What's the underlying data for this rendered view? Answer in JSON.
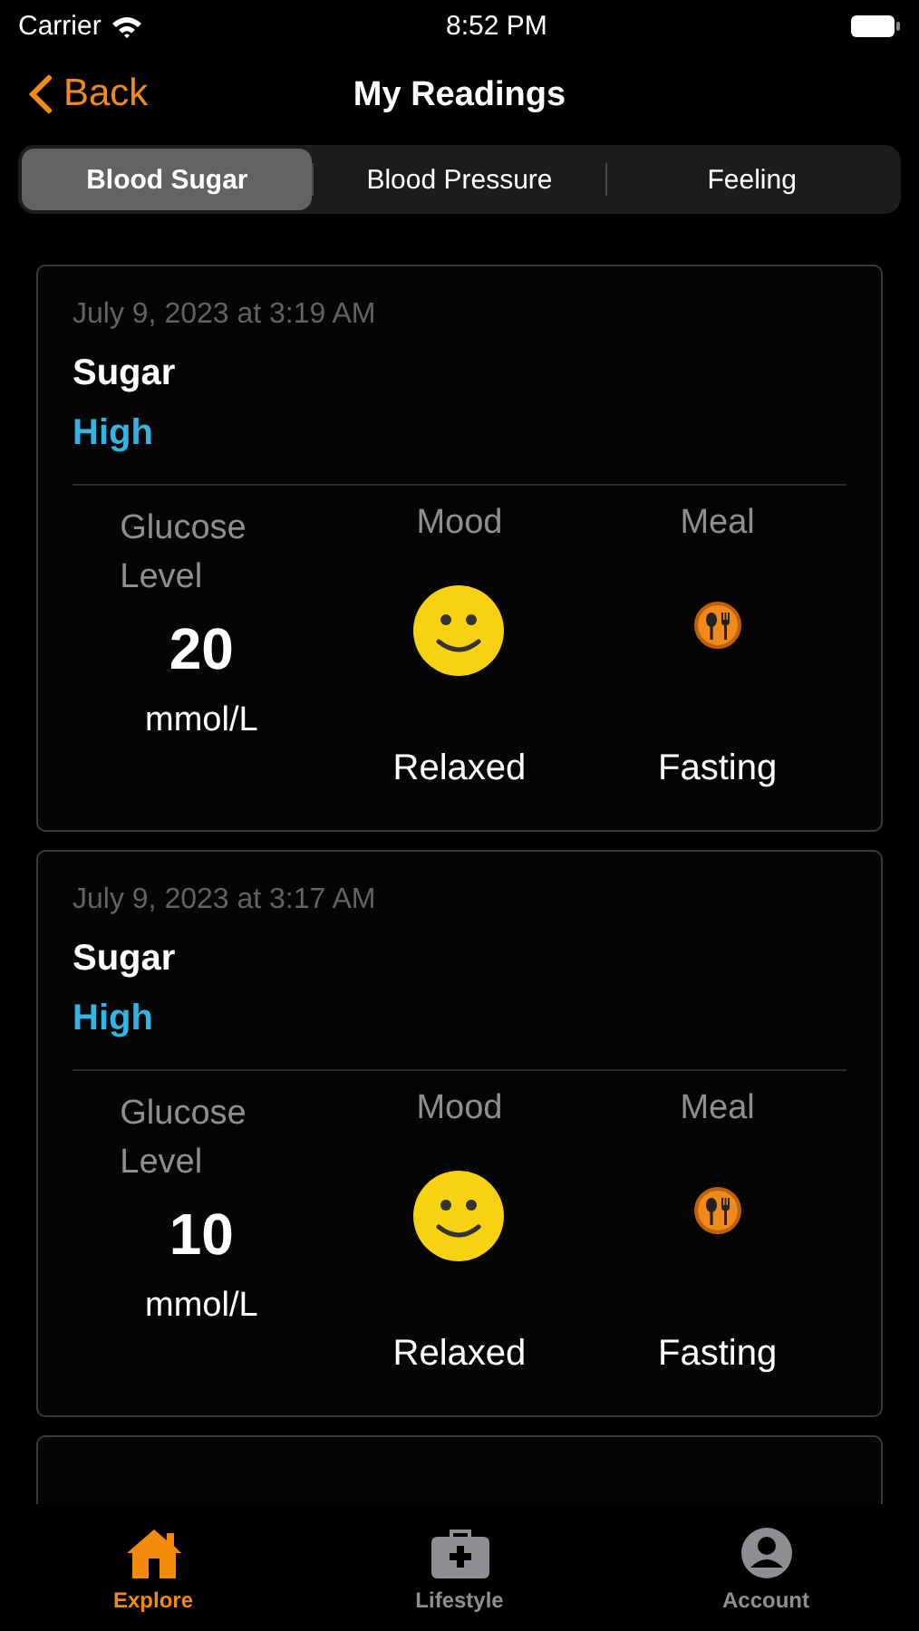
{
  "status_bar": {
    "carrier": "Carrier",
    "time": "8:52 PM"
  },
  "nav": {
    "back": "Back",
    "title": "My Readings"
  },
  "tabs": [
    {
      "label": "Blood Sugar",
      "selected": true
    },
    {
      "label": "Blood Pressure",
      "selected": false
    },
    {
      "label": "Feeling",
      "selected": false
    }
  ],
  "readings": [
    {
      "date": "July 9, 2023 at 3:19 AM",
      "title": "Sugar",
      "status": "High",
      "glucose_label": "Glucose Level",
      "glucose_value": "20",
      "unit": "mmol/L",
      "mood_label": "Mood",
      "mood": "Relaxed",
      "meal_label": "Meal",
      "meal": "Fasting"
    },
    {
      "date": "July 9, 2023 at 3:17 AM",
      "title": "Sugar",
      "status": "High",
      "glucose_label": "Glucose Level",
      "glucose_value": "10",
      "unit": "mmol/L",
      "mood_label": "Mood",
      "mood": "Relaxed",
      "meal_label": "Meal",
      "meal": "Fasting"
    }
  ],
  "tab_bar": [
    {
      "label": "Explore",
      "kind": "home",
      "selected": true
    },
    {
      "label": "Lifestyle",
      "kind": "kit",
      "selected": false
    },
    {
      "label": "Account",
      "kind": "person",
      "selected": false
    }
  ]
}
